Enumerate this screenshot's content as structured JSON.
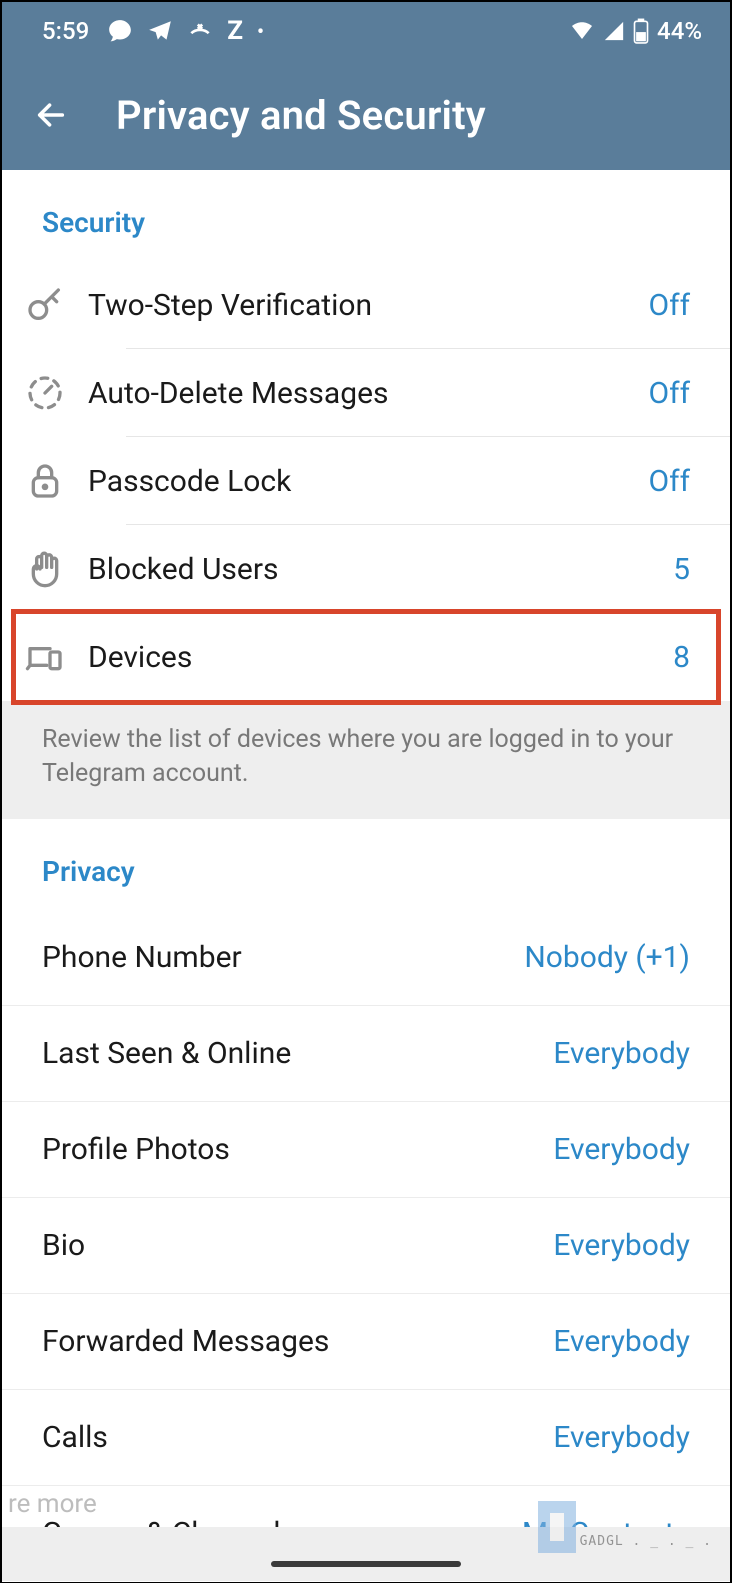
{
  "status": {
    "time": "5:59",
    "battery": "44%"
  },
  "header": {
    "title": "Privacy and Security"
  },
  "sections": {
    "security": {
      "title": "Security",
      "items": [
        {
          "label": "Two-Step Verification",
          "value": "Off"
        },
        {
          "label": "Auto-Delete Messages",
          "value": "Off"
        },
        {
          "label": "Passcode Lock",
          "value": "Off"
        },
        {
          "label": "Blocked Users",
          "value": "5"
        },
        {
          "label": "Devices",
          "value": "8"
        }
      ],
      "note": "Review the list of devices where you are logged in to your Telegram account."
    },
    "privacy": {
      "title": "Privacy",
      "items": [
        {
          "label": "Phone Number",
          "value": "Nobody (+1)"
        },
        {
          "label": "Last Seen & Online",
          "value": "Everybody"
        },
        {
          "label": "Profile Photos",
          "value": "Everybody"
        },
        {
          "label": "Bio",
          "value": "Everybody"
        },
        {
          "label": "Forwarded Messages",
          "value": "Everybody"
        },
        {
          "label": "Calls",
          "value": "Everybody"
        },
        {
          "label": "Groups & Channels",
          "value": "My Contacts"
        }
      ]
    }
  },
  "partial_text": "re more",
  "watermark": "GADGL . _ . _ ."
}
